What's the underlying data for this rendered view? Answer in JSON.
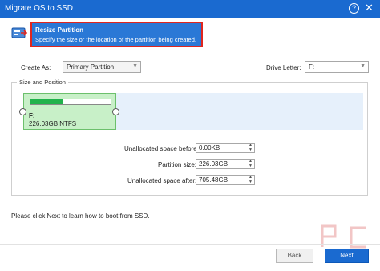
{
  "window": {
    "title": "Migrate OS to SSD",
    "help_label": "?",
    "close_label": "✕"
  },
  "header": {
    "title": "Resize Partition",
    "subtitle": "Specify the size or the location of the partition being created."
  },
  "form": {
    "create_as_label": "Create As:",
    "create_as_value": "Primary Partition",
    "drive_letter_label": "Drive Letter:",
    "drive_letter_value": "F:"
  },
  "group": {
    "title": "Size and Position"
  },
  "partition": {
    "letter": "F:",
    "size_fs": "226.03GB NTFS",
    "fill_fraction": 0.4
  },
  "fields": {
    "unalloc_before_label": "Unallocated space before:",
    "unalloc_before_value": "0.00KB",
    "partition_size_label": "Partition size:",
    "partition_size_value": "226.03GB",
    "unalloc_after_label": "Unallocated space after:",
    "unalloc_after_value": "705.48GB"
  },
  "note": "Please click Next to learn how to boot from SSD.",
  "buttons": {
    "back": "Back",
    "next": "Next"
  },
  "colors": {
    "accent": "#1a6ad0",
    "highlight": "#e0261e",
    "partition": "#c8f0c8",
    "bar": "#21b24b"
  },
  "icons": {
    "drive": "ssd-drive-icon",
    "help": "help-icon",
    "close": "close-icon",
    "watermark": "pc-logo"
  }
}
